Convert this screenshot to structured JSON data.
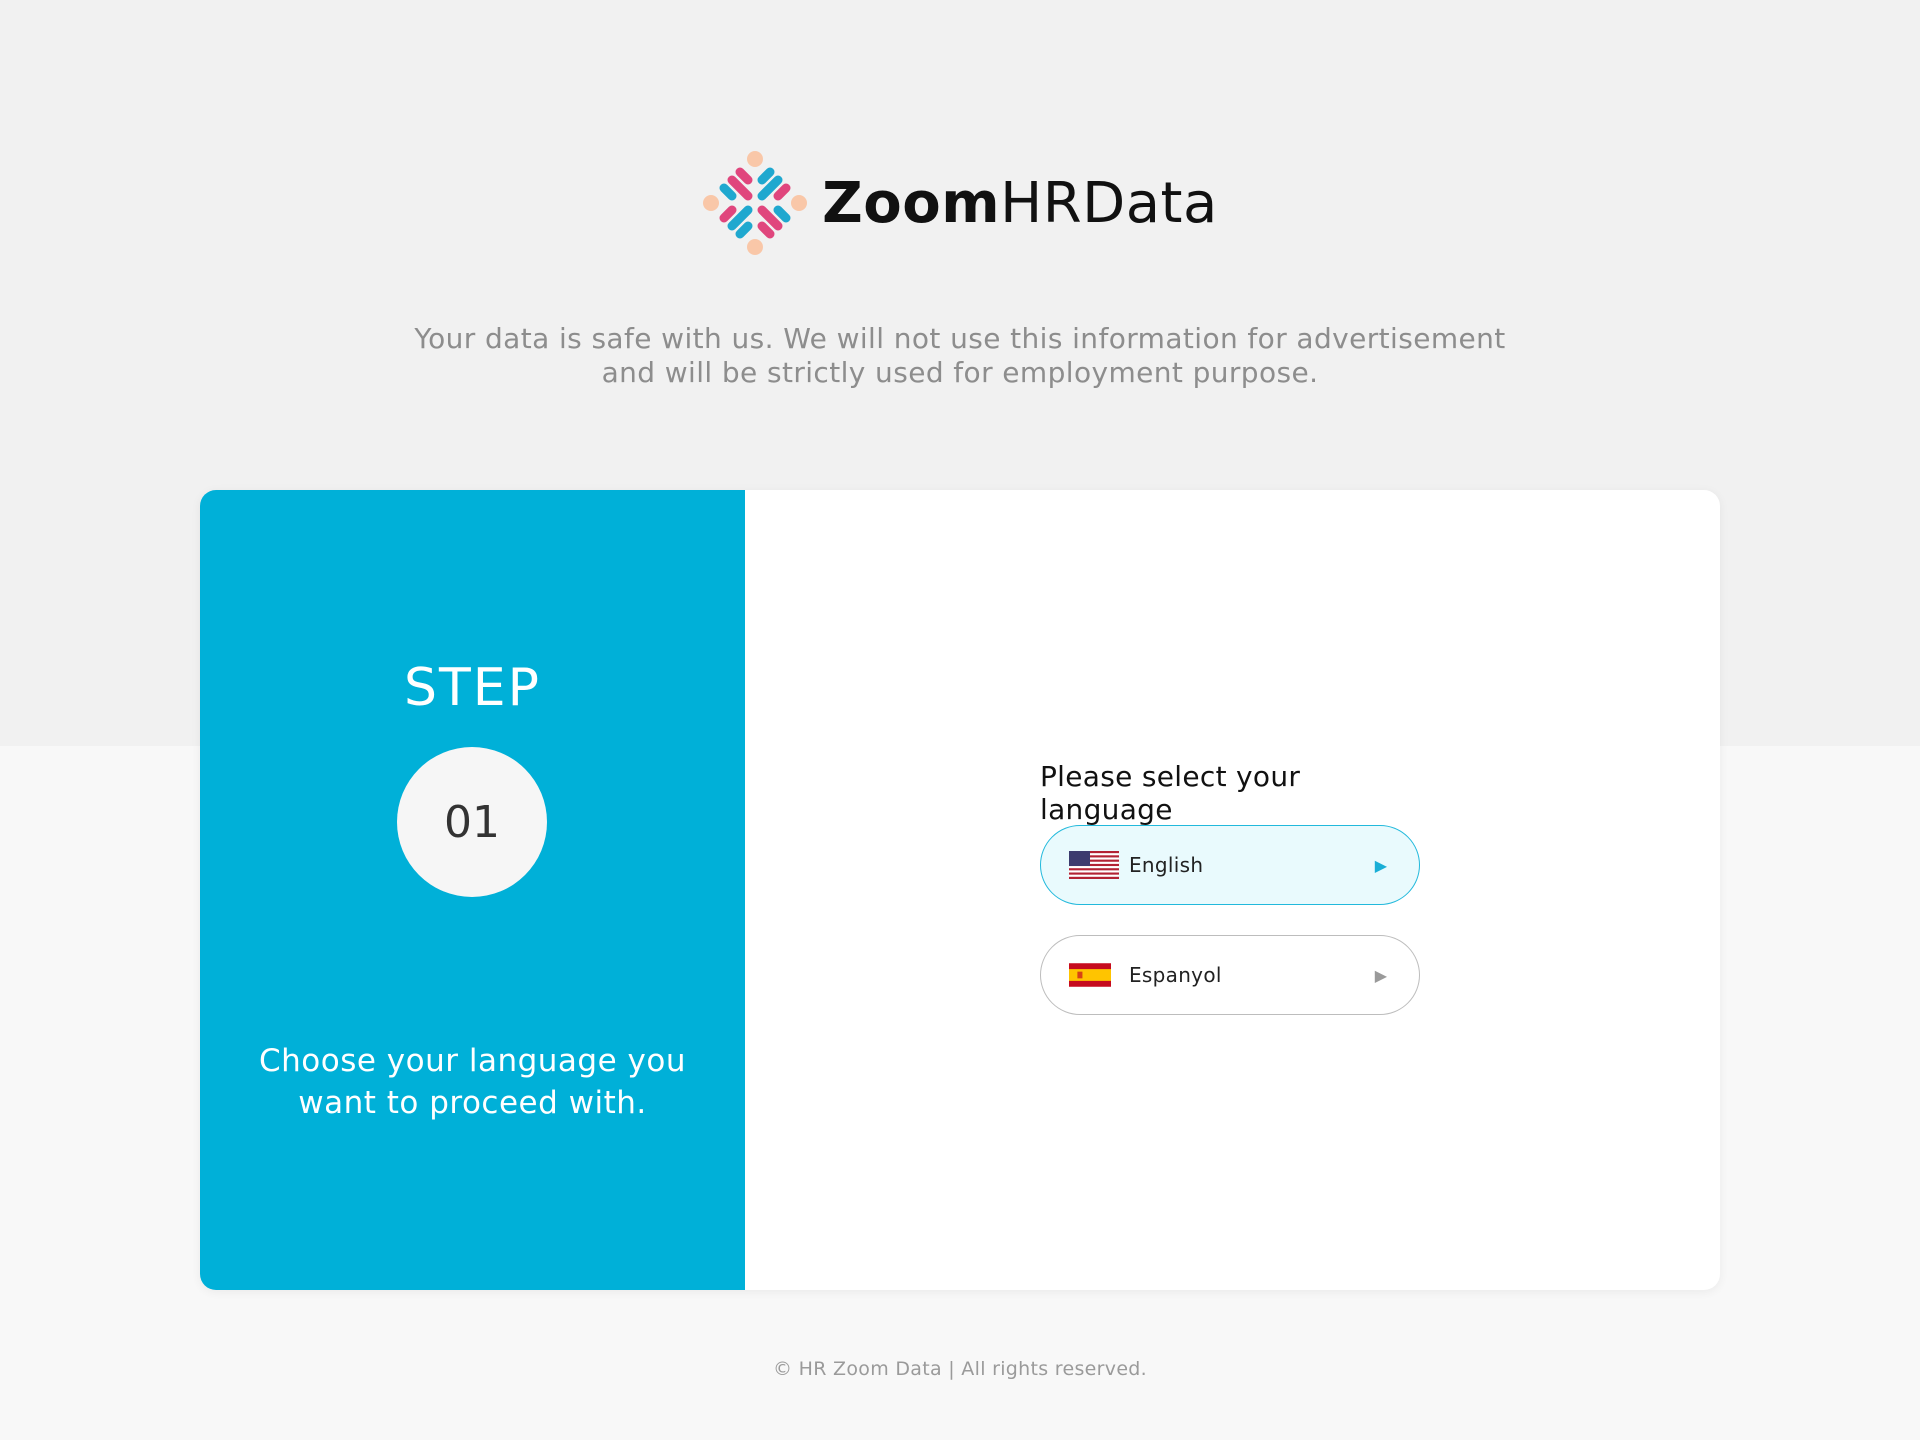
{
  "brand": {
    "name_bold": "Zoom",
    "name_regular": "HRData",
    "logo_icon": "people-circle-logo-icon"
  },
  "tagline": {
    "line1": "Your data is safe with us. We will not use this information for advertisement",
    "line2": "and will be strictly used for employment purpose."
  },
  "step": {
    "label": "STEP",
    "number": "01",
    "description_line1": "Choose your language you",
    "description_line2": "want to proceed with."
  },
  "language": {
    "title": "Please select your language",
    "options": [
      {
        "label": "English",
        "flag": "us-flag-icon",
        "selected": true
      },
      {
        "label": "Espanyol",
        "flag": "spain-flag-icon",
        "selected": false
      }
    ]
  },
  "footer": {
    "text": "© HR Zoom Data | All rights reserved."
  },
  "colors": {
    "accent": "#00b0d8",
    "accent_light": "#e9fafd",
    "logo_pink": "#e0467d",
    "logo_blue": "#1fa8cf",
    "logo_peach": "#f9c7a8"
  }
}
